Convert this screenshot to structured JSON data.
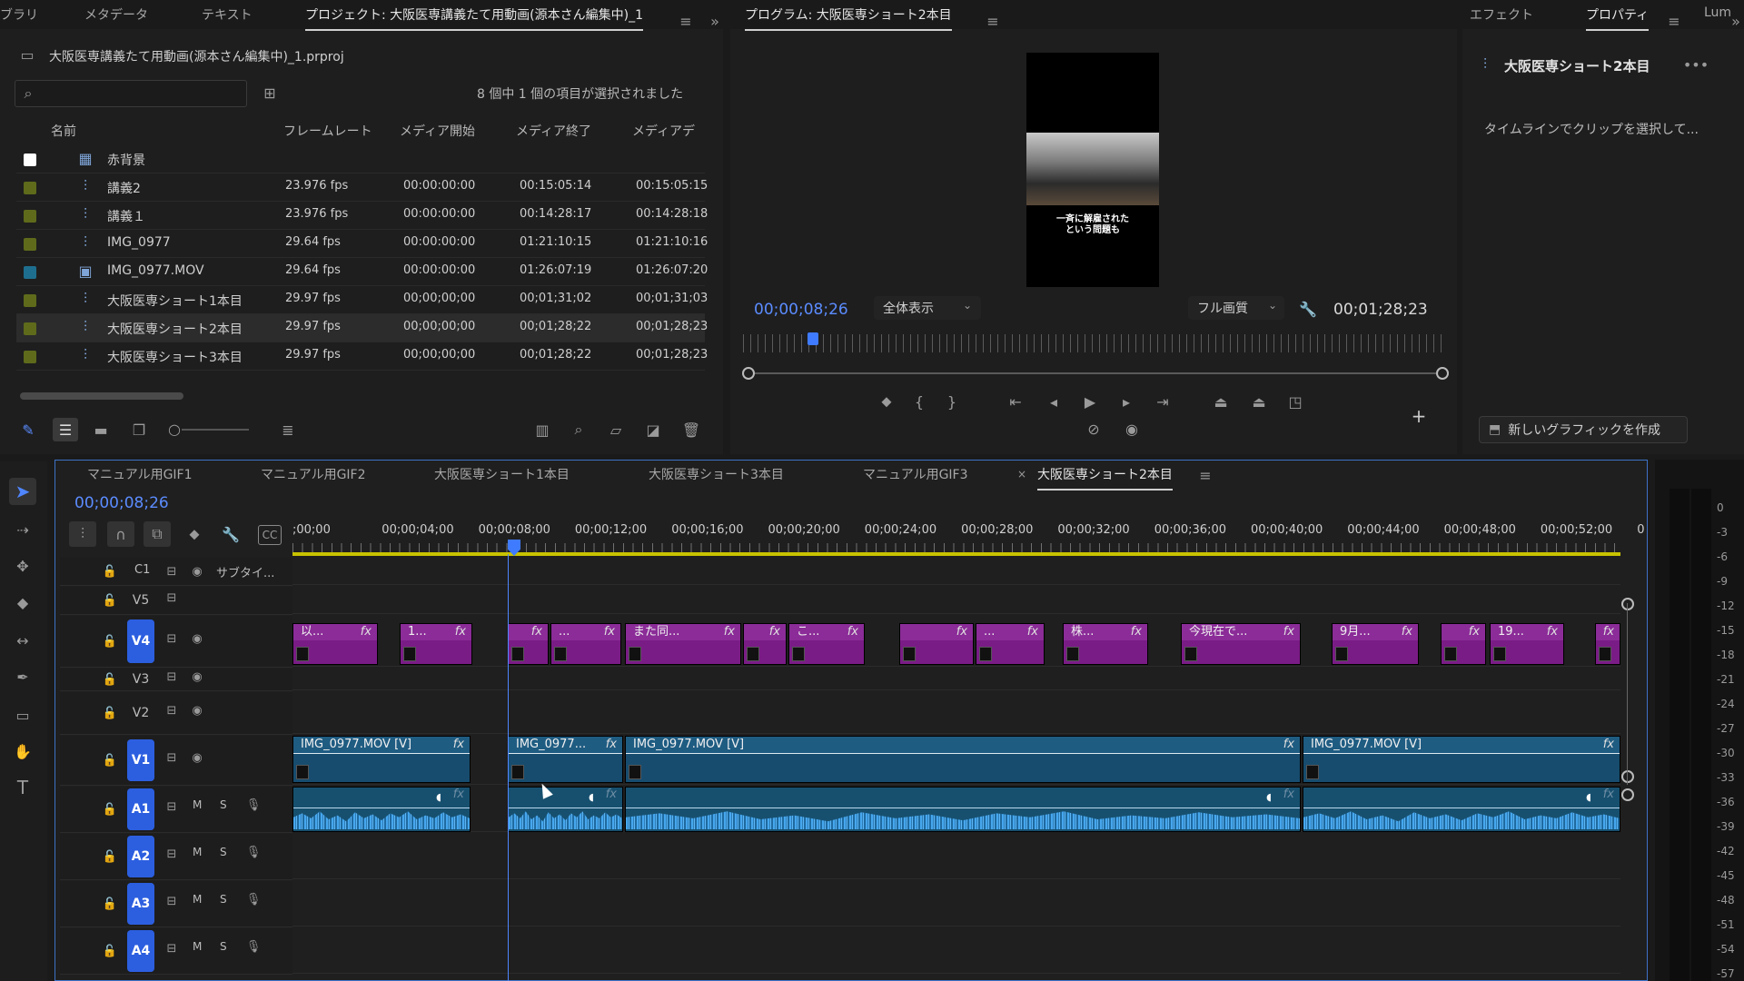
{
  "project_panel": {
    "tabs": [
      "ブラリ",
      "メタデータ",
      "テキスト",
      "プロジェクト: 大阪医専講義たて用動画(源本さん編集中)_1"
    ],
    "menu_icon": "hamburger-icon",
    "more_icon": "double-chevron-icon",
    "file_name": "大阪医専講義たて用動画(源本さん編集中)_1.prproj",
    "search_placeholder": "",
    "selection_status": "8 個中 1 個の項目が選択されました",
    "columns": [
      "名前",
      "フレームレート",
      "メディア開始",
      "メディア終了",
      "メディアデ"
    ],
    "items": [
      {
        "name": "赤背景",
        "fps": "",
        "start": "",
        "end": "",
        "dur": "",
        "color": "#ffffff",
        "icon": "graphic-icon"
      },
      {
        "name": "講義2",
        "fps": "23.976 fps",
        "start": "00:00:00:00",
        "end": "00:15:05:14",
        "dur": "00:15:05:15",
        "color": "#5f6b1b",
        "icon": "sequence-icon"
      },
      {
        "name": "講義１",
        "fps": "23.976 fps",
        "start": "00:00:00:00",
        "end": "00:14:28:17",
        "dur": "00:14:28:18",
        "color": "#5f6b1b",
        "icon": "sequence-icon"
      },
      {
        "name": "IMG_0977",
        "fps": "29.64 fps",
        "start": "00:00:00:00",
        "end": "01:21:10:15",
        "dur": "01:21:10:16",
        "color": "#5f6b1b",
        "icon": "sequence-icon"
      },
      {
        "name": "IMG_0977.MOV",
        "fps": "29.64 fps",
        "start": "00:00:00:00",
        "end": "01:26:07:19",
        "dur": "01:26:07:20",
        "color": "#1e6f8f",
        "icon": "video-file-icon"
      },
      {
        "name": "大阪医専ショート1本目",
        "fps": "29.97 fps",
        "start": "00;00;00;00",
        "end": "00;01;31;02",
        "dur": "00;01;31;03",
        "color": "#5f6b1b",
        "icon": "sequence-icon"
      },
      {
        "name": "大阪医専ショート2本目",
        "fps": "29.97 fps",
        "start": "00;00;00;00",
        "end": "00;01;28;22",
        "dur": "00;01;28;23",
        "color": "#5f6b1b",
        "icon": "sequence-icon"
      },
      {
        "name": "大阪医専ショート3本目",
        "fps": "29.97 fps",
        "start": "00;00;00;00",
        "end": "00;01;28;22",
        "dur": "00;01;28;23",
        "color": "#5f6b1b",
        "icon": "sequence-icon"
      }
    ],
    "selected_index": 6
  },
  "program_monitor": {
    "title": "プログラム: 大阪医専ショート2本目",
    "caption": "一斉に解雇された\nという問題も",
    "timecode": "00;00;08;26",
    "zoom": "全体表示",
    "quality": "フル画質",
    "duration": "00;01;28;23",
    "playhead_fraction": 0.1
  },
  "right_panel": {
    "tabs": [
      "エフェクト",
      "プロパティ",
      "Lum"
    ],
    "sequence_name": "大阪医専ショート2本目",
    "hint": "タイムラインでクリップを選択して...",
    "new_graphic": "新しいグラフィックを作成"
  },
  "timeline": {
    "tabs": [
      "マニュアル用GIF1",
      "マニュアル用GIF2",
      "大阪医専ショート1本目",
      "大阪医専ショート3本目",
      "マニュアル用GIF3",
      "大阪医専ショート2本目"
    ],
    "active_tab": "大阪医専ショート2本目",
    "timecode": "00;00;08;26",
    "ruler": [
      ";00;00",
      "00;00;04;00",
      "00;00;08;00",
      "00;00;12;00",
      "00;00;16;00",
      "00;00;20;00",
      "00;00;24;00",
      "00;00;28;00",
      "00;00;32;00",
      "00;00;36;00",
      "00;00;40;00",
      "00;00;44;00",
      "00;00;48;00",
      "00;00;52;00",
      "0"
    ],
    "tracks": {
      "c1": {
        "label": "C1",
        "name": "サブタイ..."
      },
      "v5": "V5",
      "v4": "V4",
      "v3": "V3",
      "v2": "V2",
      "v1": "V1",
      "a1": "A1",
      "a2": "A2",
      "a3": "A3",
      "a4": "A4",
      "m": "M",
      "s": "S"
    },
    "v4_clips": [
      "以...",
      "1...",
      "",
      "...",
      "また同...",
      "",
      "こ...",
      "",
      "...",
      "株...",
      "今現在で...",
      "9月...",
      "",
      "19...",
      ""
    ],
    "v1_clips": [
      "IMG_0977.MOV [V]",
      "IMG_0977...",
      "IMG_0977.MOV [V]",
      "IMG_0977.MOV [V]"
    ],
    "fx": "fx"
  },
  "vu_meter": [
    "0",
    "-3",
    "-6",
    "-9",
    "-12",
    "-15",
    "-18",
    "-21",
    "-24",
    "-27",
    "-30",
    "-33",
    "-36",
    "-39",
    "-42",
    "-45",
    "-48",
    "-51",
    "-54",
    "-57"
  ]
}
